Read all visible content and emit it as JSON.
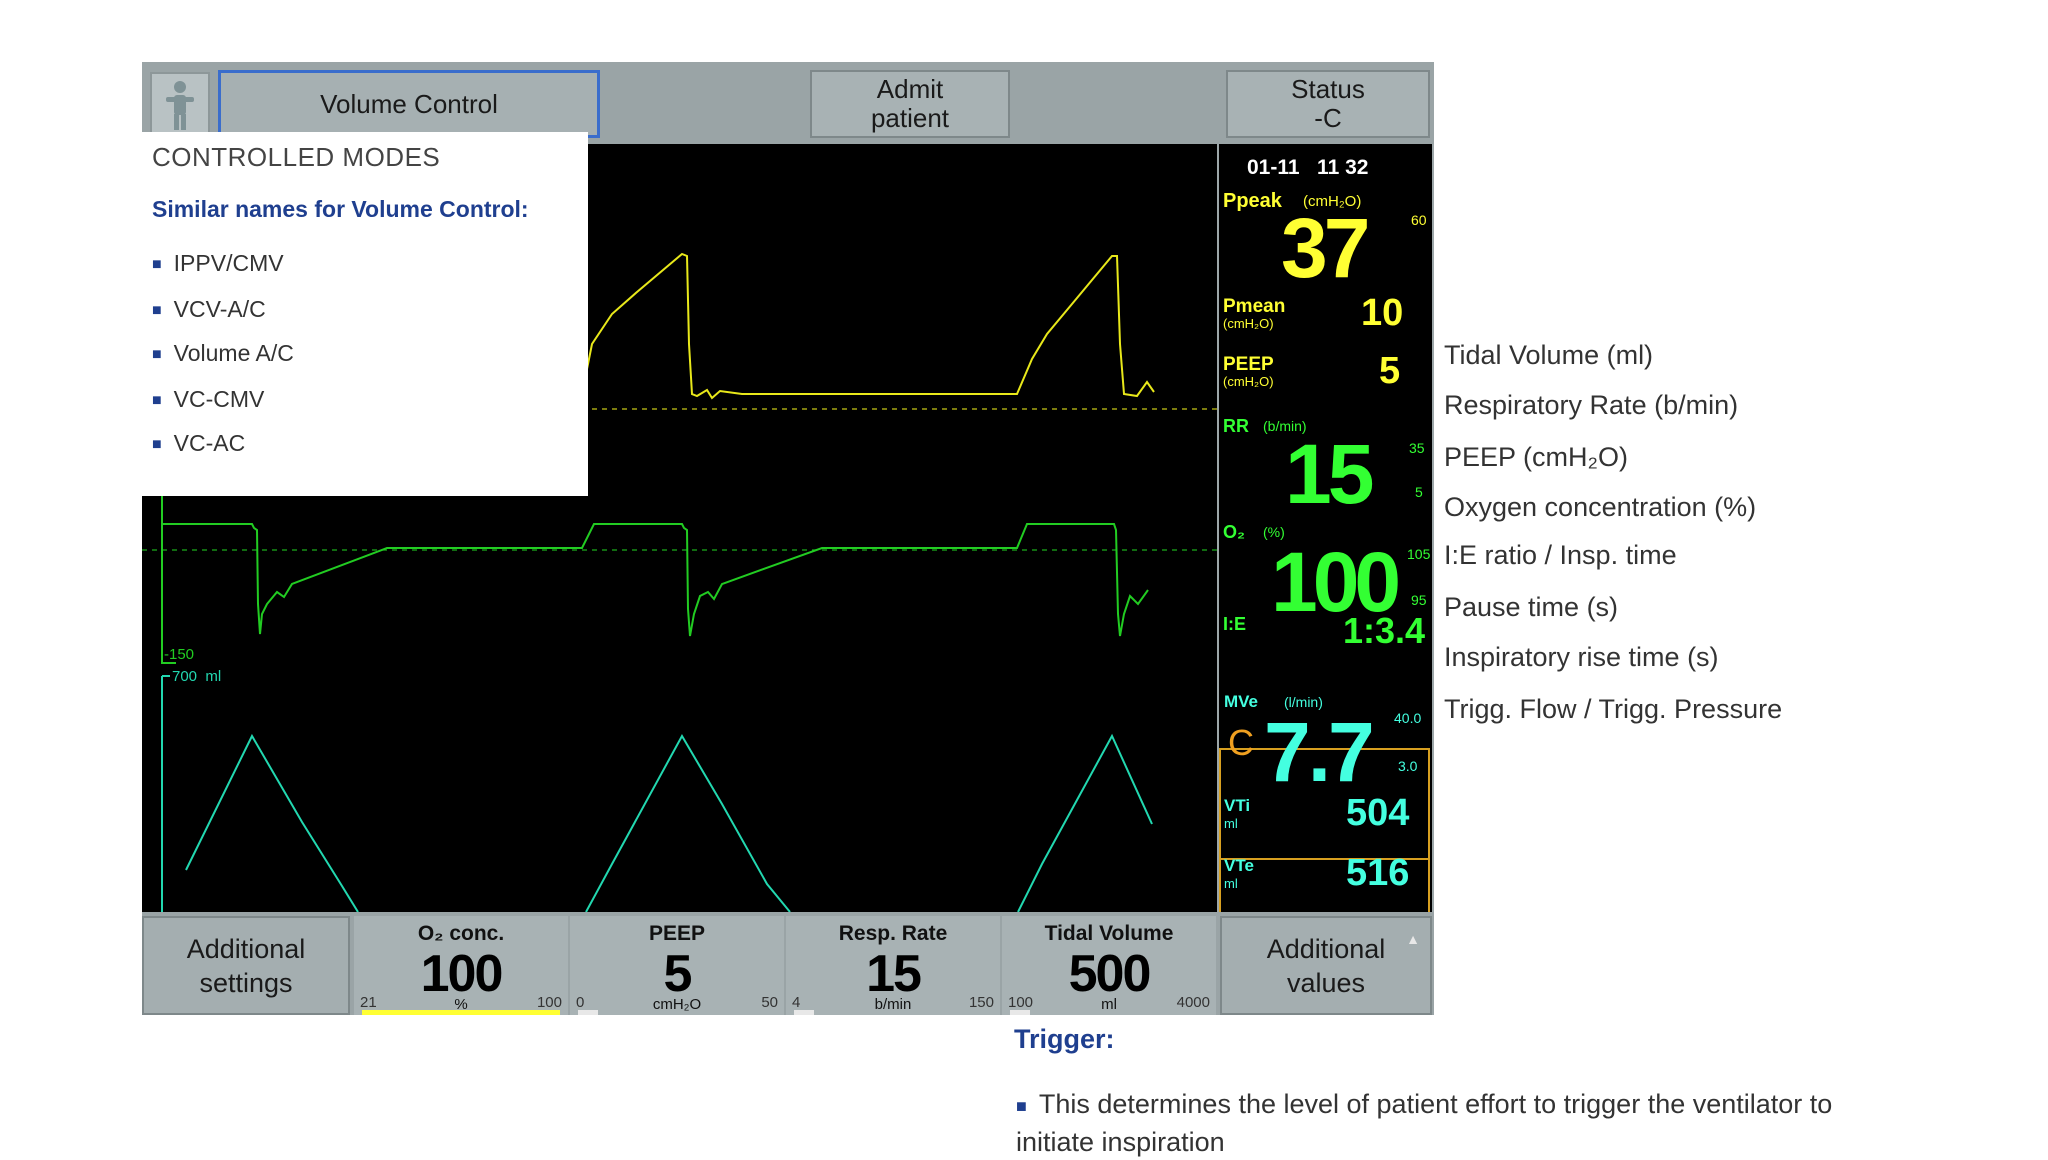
{
  "header": {
    "mode_button": "Volume Control",
    "admit_line1": "Admit",
    "admit_line2": "patient",
    "status_line1": "Status",
    "status_line2": "-C"
  },
  "readouts": {
    "datetime": "01-11   11 32",
    "ppeak_label": "Ppeak",
    "ppeak_unit": "(cmH₂O)",
    "ppeak_value": "37",
    "ppeak_limit": "60",
    "pmean_label": "Pmean",
    "pmean_unit": "(cmH₂O)",
    "pmean_value": "10",
    "peep_label": "PEEP",
    "peep_unit": "(cmH₂O)",
    "peep_value": "5",
    "rr_label": "RR",
    "rr_unit": "(b/min)",
    "rr_value": "15",
    "rr_high": "35",
    "rr_low": "5",
    "o2_label": "O₂",
    "o2_unit": "(%)",
    "o2_value": "100",
    "o2_high": "105",
    "o2_low": "95",
    "ie_label": "I:E",
    "ie_value": "1:3.4",
    "mve_label": "MVe",
    "mve_unit": "(l/min)",
    "mve_c": "C",
    "mve_value": "7.7",
    "mve_high": "40.0",
    "mve_low": "3.0",
    "vti_label": "VTi",
    "vti_unit": "ml",
    "vti_value": "504",
    "vte_label": "VTe",
    "vte_unit": "ml",
    "vte_value": "516"
  },
  "waveform": {
    "flow_min_label": "-150",
    "volume_scale_label": "700  ml"
  },
  "bottom": {
    "add_settings_1": "Additional",
    "add_settings_2": "settings",
    "add_values_1": "Additional",
    "add_values_2": "values",
    "params": [
      {
        "label": "O₂ conc.",
        "value": "100",
        "unit": "%",
        "min": "21",
        "max": "100",
        "fill": 1.0,
        "color": "#ffff33"
      },
      {
        "label": "PEEP",
        "value": "5",
        "unit": "cmH₂O",
        "min": "0",
        "max": "50",
        "fill": 0.1,
        "color": "#e8e8e8"
      },
      {
        "label": "Resp. Rate",
        "value": "15",
        "unit": "b/min",
        "min": "4",
        "max": "150",
        "fill": 0.1,
        "color": "#e8e8e8"
      },
      {
        "label": "Tidal Volume",
        "value": "500",
        "unit": "ml",
        "min": "100",
        "max": "4000",
        "fill": 0.1,
        "color": "#e8e8e8"
      }
    ]
  },
  "popup": {
    "title": "CONTROLLED MODES",
    "subtitle": "Similar names for Volume Control:",
    "items": [
      "IPPV/CMV",
      "VCV-A/C",
      "Volume A/C",
      "VC-CMV",
      "VC-AC"
    ]
  },
  "side_list": [
    "Tidal Volume (ml)",
    "Respiratory Rate (b/min)",
    "PEEP (cmH₂O)",
    "Oxygen concentration (%)",
    "I:E ratio / Insp. time",
    "Pause time (s)",
    "Inspiratory rise time (s)",
    "Trigg. Flow / Trigg. Pressure"
  ],
  "trigger": {
    "title": "Trigger:",
    "text": "This determines the level of patient effort to trigger the ventilator to initiate inspiration"
  },
  "colors": {
    "pressure_wave": "#e8e81a",
    "flow_wave": "#22cc22",
    "volume_wave": "#22d8b0",
    "accent_blue": "#1f3f8f"
  }
}
